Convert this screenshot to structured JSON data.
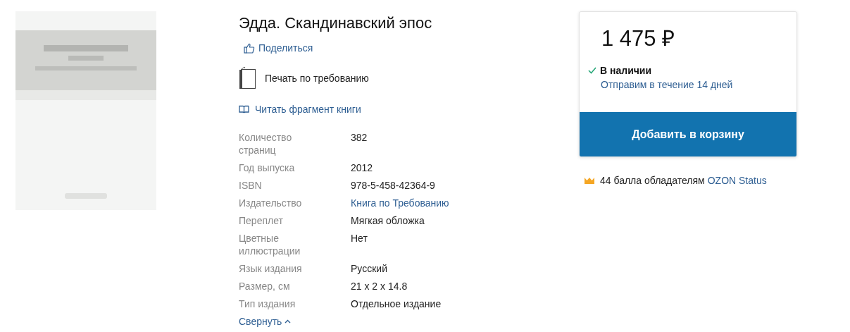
{
  "title": "Эдда. Скандинавский эпос",
  "share": {
    "label": "Поделиться"
  },
  "format": {
    "label": "Печать по требованию"
  },
  "read_fragment": {
    "label": "Читать фрагмент книги"
  },
  "specs": [
    {
      "label": "Количество страниц",
      "value": "382",
      "kind": "text"
    },
    {
      "label": "Год выпуска",
      "value": "2012",
      "kind": "text"
    },
    {
      "label": "ISBN",
      "value": "978-5-458-42364-9",
      "kind": "text"
    },
    {
      "label": "Издательство",
      "value": "Книга по Требованию",
      "kind": "link"
    },
    {
      "label": "Переплет",
      "value": "Мягкая обложка",
      "kind": "text"
    },
    {
      "label": "Цветные иллюстрации",
      "value": "Нет",
      "kind": "text"
    },
    {
      "label": "Язык издания",
      "value": "Русский",
      "kind": "text"
    },
    {
      "label": "Размер, см",
      "value": "21 x 2 x 14.8",
      "kind": "text"
    },
    {
      "label": "Тип издания",
      "value": "Отдельное издание",
      "kind": "text"
    }
  ],
  "collapse": {
    "label": "Свернуть",
    "expanded": true
  },
  "purchase": {
    "price": "1 475 ₽",
    "in_stock": true,
    "stock_label": "В наличии",
    "shipping": "Отправим в течение 14 дней",
    "button": "Добавить в корзину"
  },
  "bonus": {
    "text": "44 балла обладателям",
    "link": "OZON Status"
  }
}
